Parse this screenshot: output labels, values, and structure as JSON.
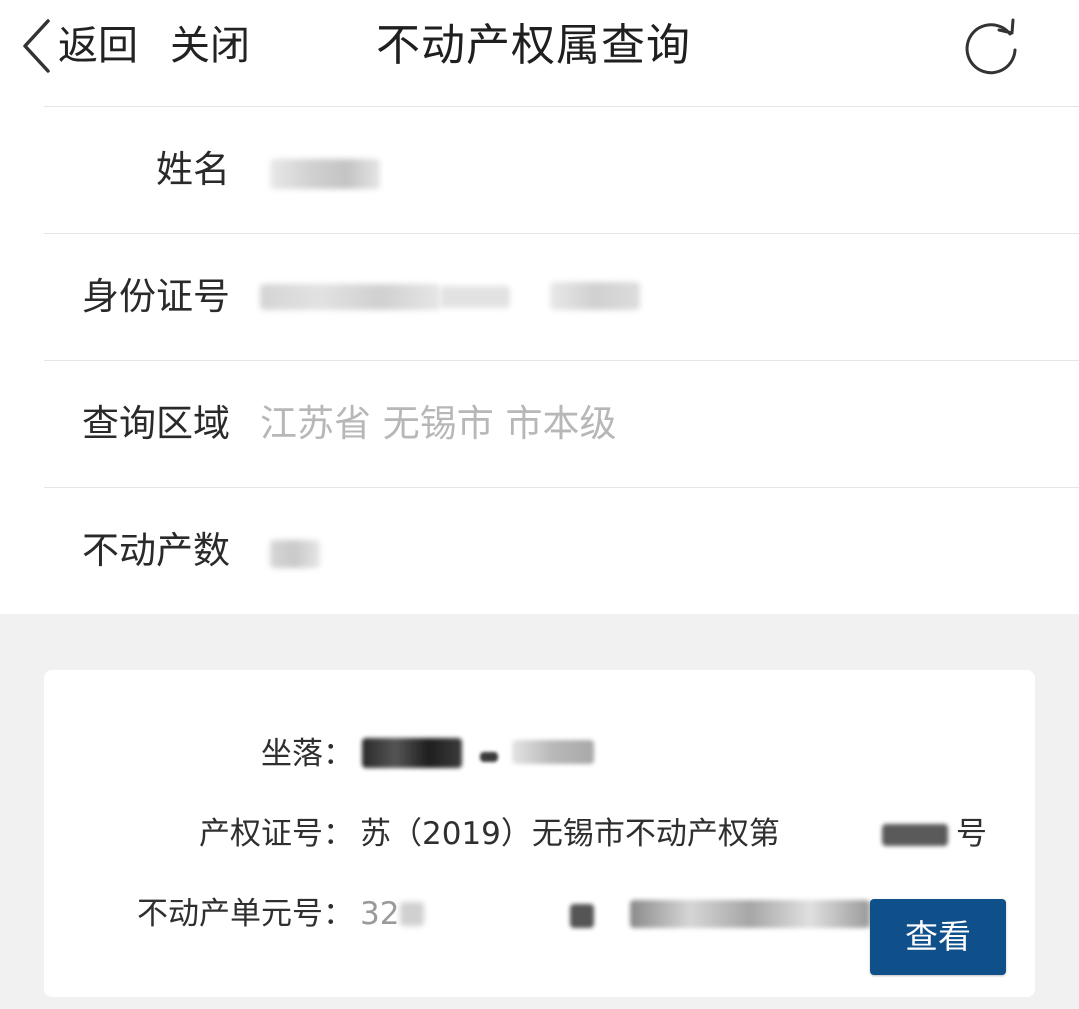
{
  "header": {
    "back_label": "返回",
    "close_label": "关闭",
    "title": "不动产权属查询"
  },
  "form": {
    "rows": [
      {
        "label": "姓名",
        "value": ""
      },
      {
        "label": "身份证号",
        "value": ""
      },
      {
        "label": "查询区域",
        "value": "江苏省 无锡市 市本级"
      },
      {
        "label": "不动产数",
        "value": ""
      }
    ]
  },
  "record": {
    "location_label": "坐落：",
    "certificate_label": "产权证号：",
    "certificate_prefix": "苏（2019）无锡市不动产权第",
    "certificate_suffix": "号",
    "unit_label": "不动产单元号：",
    "unit_prefix": "32",
    "view_button": "查看"
  },
  "colors": {
    "accent": "#0f4f8a",
    "background_gray": "#f1f1f1",
    "placeholder_text": "#b7b7b7"
  }
}
